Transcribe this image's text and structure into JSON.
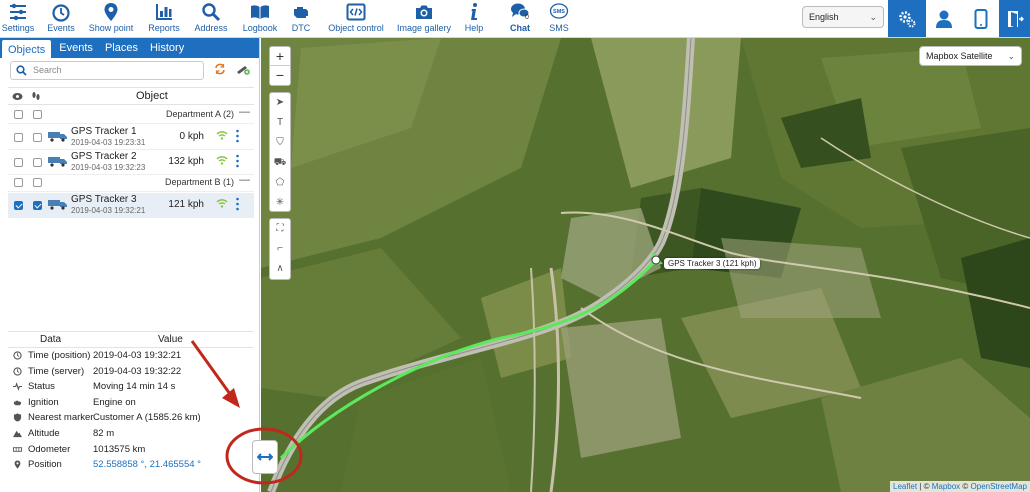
{
  "toolbar": {
    "items": [
      {
        "label": "Settings",
        "icon": "settings-sliders-icon"
      },
      {
        "label": "Events",
        "icon": "clock-icon"
      },
      {
        "label": "Show point",
        "icon": "map-pin-icon"
      },
      {
        "label": "Reports",
        "icon": "chart-icon"
      },
      {
        "label": "Address",
        "icon": "search-icon"
      },
      {
        "label": "Logbook",
        "icon": "book-icon"
      },
      {
        "label": "DTC",
        "icon": "engine-icon"
      },
      {
        "label": "Object control",
        "icon": "code-icon"
      },
      {
        "label": "Image gallery",
        "icon": "camera-icon"
      },
      {
        "label": "Help",
        "icon": "info-icon"
      }
    ],
    "chat": {
      "label": "Chat",
      "count": "0"
    },
    "sms": {
      "label": "SMS",
      "badge": "SMS"
    },
    "language": "English",
    "accent": "#1e6fbf"
  },
  "left_panel": {
    "tabs": [
      "Objects",
      "Events",
      "Places",
      "History"
    ],
    "search_placeholder": "Search",
    "object_column": "Object",
    "groups": [
      {
        "name": "Department A (2)",
        "objects": [
          {
            "name": "GPS Tracker 1",
            "time": "2019-04-03 19:23:31",
            "speed": "0 kph",
            "checked": false
          },
          {
            "name": "GPS Tracker 2",
            "time": "2019-04-03 19:32:23",
            "speed": "132 kph",
            "checked": false
          }
        ]
      },
      {
        "name": "Department B (1)",
        "objects": [
          {
            "name": "GPS Tracker 3",
            "time": "2019-04-03 19:32:21",
            "speed": "121 kph",
            "checked": true
          }
        ]
      }
    ],
    "details": {
      "headers": [
        "Data",
        "Value"
      ],
      "rows": [
        {
          "key": "Time (position)",
          "value": "2019-04-03 19:32:21",
          "icon": "clock-icon"
        },
        {
          "key": "Time (server)",
          "value": "2019-04-03 19:32:22",
          "icon": "clock-icon"
        },
        {
          "key": "Status",
          "value": "Moving 14 min 14 s",
          "icon": "pulse-icon"
        },
        {
          "key": "Ignition",
          "value": "Engine on",
          "icon": "engine-icon"
        },
        {
          "key": "Nearest marker",
          "value": "Customer A (1585.26 km)",
          "icon": "shield-icon"
        },
        {
          "key": "Altitude",
          "value": "82 m",
          "icon": "mountain-icon"
        },
        {
          "key": "Odometer",
          "value": "1013575 km",
          "icon": "odometer-icon"
        },
        {
          "key": "Position",
          "value": "52.558858 °, 21.465554 °",
          "icon": "pin-icon"
        }
      ]
    }
  },
  "map": {
    "layer": "Mapbox Satellite",
    "zoom_in": "+",
    "zoom_out": "−",
    "marker_label": "GPS Tracker 3 (121 kph)",
    "attribution": {
      "leaflet": "Leaflet",
      "sep1": " | © ",
      "mapbox": "Mapbox",
      "sep2": " © ",
      "osm": "OpenStreetMap"
    }
  }
}
